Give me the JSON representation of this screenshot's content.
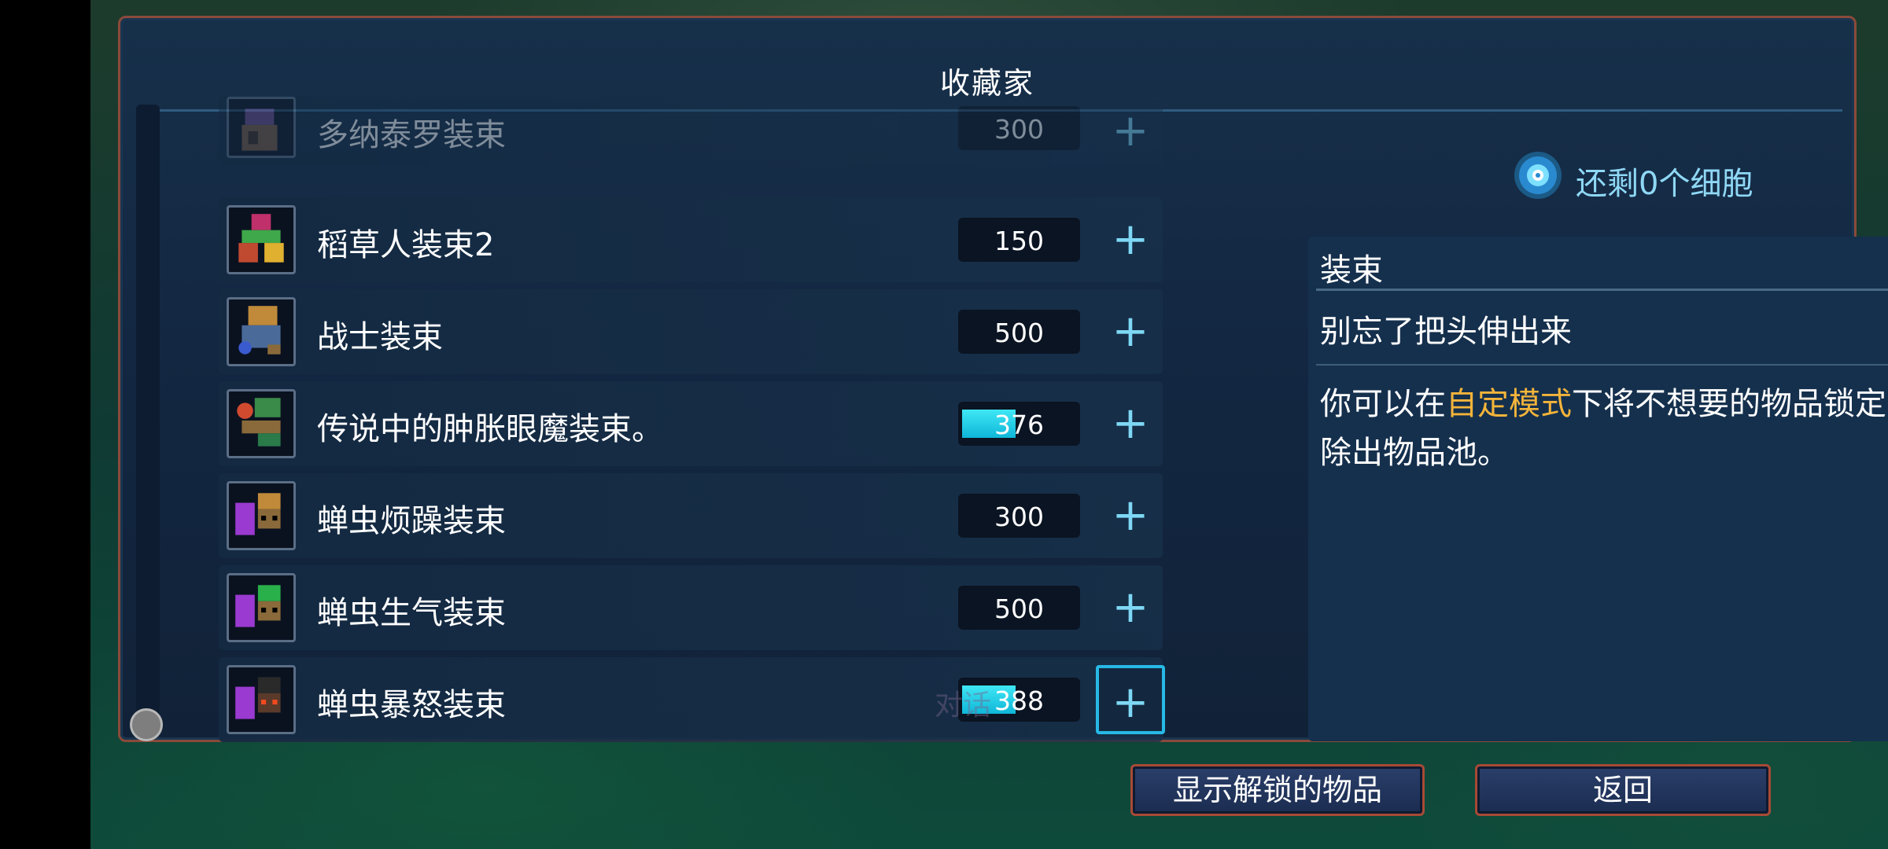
{
  "panel": {
    "title": "收藏家"
  },
  "items": [
    {
      "name": "多纳泰罗装束",
      "cost": "300",
      "progress": 0,
      "faded": true
    },
    {
      "name": "稻草人装束2",
      "cost": "150",
      "progress": 0
    },
    {
      "name": "战士装束",
      "cost": "500",
      "progress": 0
    },
    {
      "name": "传说中的肿胀眼魔装束。",
      "cost": "376",
      "progress": 0.47
    },
    {
      "name": "蝉虫烦躁装束",
      "cost": "300",
      "progress": 0
    },
    {
      "name": "蝉虫生气装束",
      "cost": "500",
      "progress": 0
    },
    {
      "name": "蝉虫暴怒装束",
      "cost": "388",
      "progress": 0.47,
      "selected": true
    }
  ],
  "plus_glyph": "+",
  "faint_label": "对话",
  "cells": {
    "text": "还剩0个细胞",
    "icon": "cell-icon"
  },
  "info": {
    "category": "装束",
    "quote": "别忘了把头伸出来",
    "desc_before": "你可以在",
    "desc_highlight": "自定模式",
    "desc_after": "下将不想要的物品锁定以排除出物品池。"
  },
  "buttons": {
    "show_unlocked": "显示解锁的物品",
    "back": "返回"
  },
  "colors": {
    "accent": "#27b9e6",
    "highlight": "#f4b43a",
    "border": "#a84a36",
    "progress": "#2fd6ec"
  }
}
